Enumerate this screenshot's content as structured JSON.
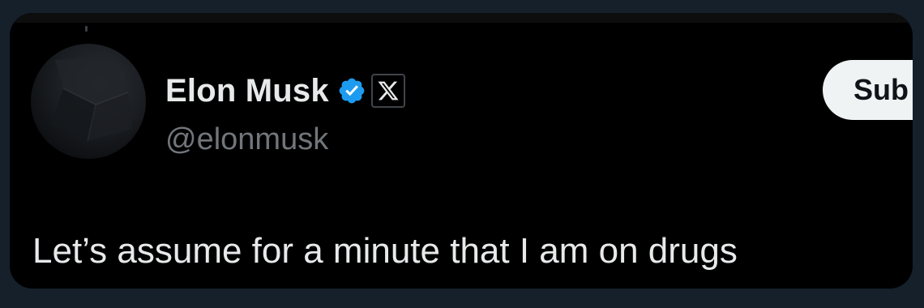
{
  "tweet": {
    "author": {
      "display_name": "Elon Musk",
      "handle": "@elonmusk",
      "verified_icon": "verified-badge-icon",
      "affiliation_icon": "x-logo-icon"
    },
    "subscribe_label": "Sub",
    "text": "Let’s assume for a minute that I am on drugs"
  },
  "colors": {
    "page_background": "#15202b",
    "card_background": "#000000",
    "primary_text": "#e7e9ea",
    "secondary_text": "#71767b",
    "verified_blue": "#1d9bf0",
    "button_background": "#eff3f4",
    "button_text": "#0f1419"
  }
}
